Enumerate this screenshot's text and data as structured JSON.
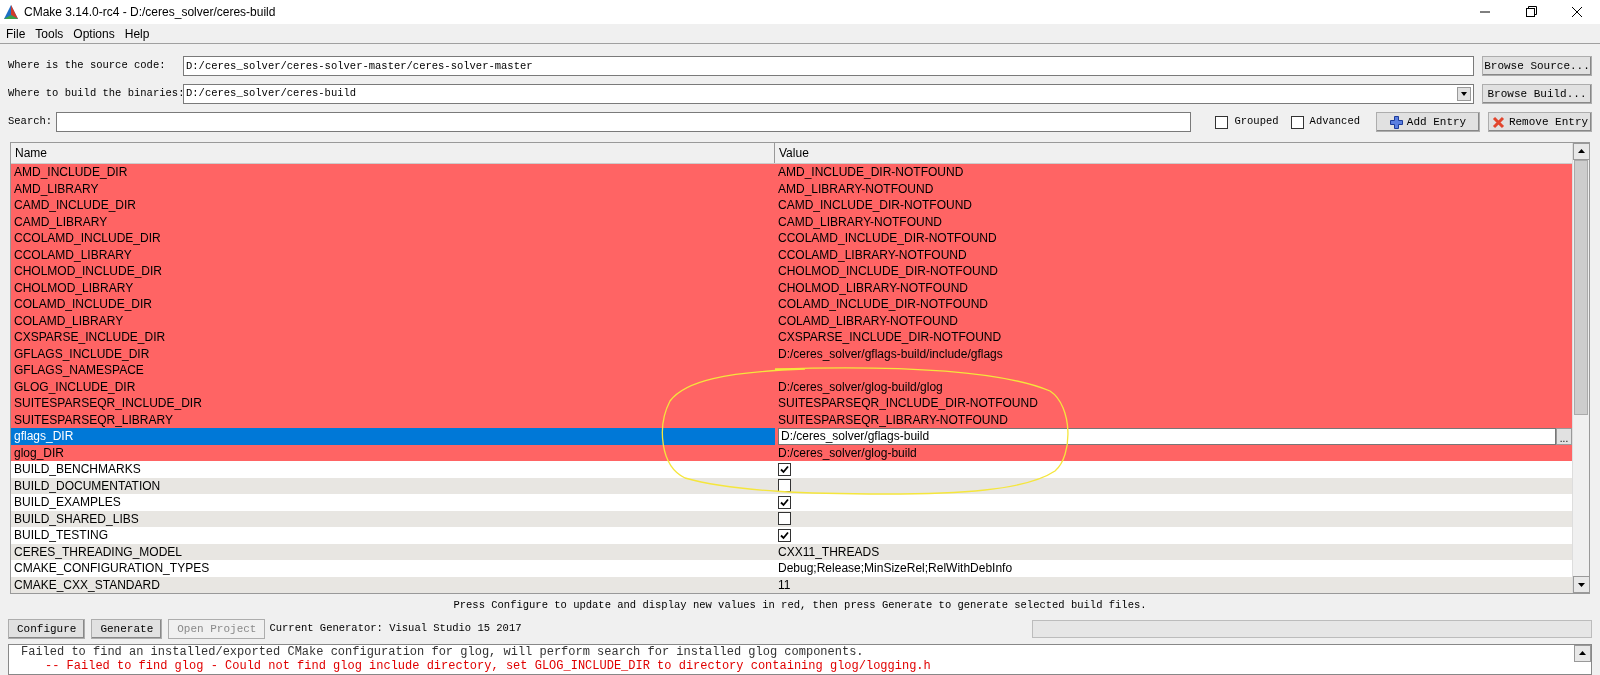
{
  "window": {
    "title": "CMake 3.14.0-rc4 - D:/ceres_solver/ceres-build"
  },
  "menu": [
    "File",
    "Tools",
    "Options",
    "Help"
  ],
  "source": {
    "label": "Where is the source code:",
    "value": "D:/ceres_solver/ceres-solver-master/ceres-solver-master",
    "button": "Browse Source..."
  },
  "build": {
    "label": "Where to build the binaries:",
    "value": "D:/ceres_solver/ceres-build",
    "button": "Browse Build..."
  },
  "search": {
    "label": "Search:"
  },
  "options": [
    {
      "label": "Grouped",
      "checked": false
    },
    {
      "label": "Advanced",
      "checked": false
    }
  ],
  "entry_buttons": [
    {
      "kind": "add",
      "label": "Add Entry"
    },
    {
      "kind": "remove",
      "label": "Remove Entry"
    }
  ],
  "table": {
    "columns": [
      "Name",
      "Value"
    ],
    "rows": [
      {
        "name": "AMD_INCLUDE_DIR",
        "kind": "text",
        "value": "AMD_INCLUDE_DIR-NOTFOUND",
        "new": true,
        "selected": false
      },
      {
        "name": "AMD_LIBRARY",
        "kind": "text",
        "value": "AMD_LIBRARY-NOTFOUND",
        "new": true,
        "selected": false
      },
      {
        "name": "CAMD_INCLUDE_DIR",
        "kind": "text",
        "value": "CAMD_INCLUDE_DIR-NOTFOUND",
        "new": true,
        "selected": false
      },
      {
        "name": "CAMD_LIBRARY",
        "kind": "text",
        "value": "CAMD_LIBRARY-NOTFOUND",
        "new": true,
        "selected": false
      },
      {
        "name": "CCOLAMD_INCLUDE_DIR",
        "kind": "text",
        "value": "CCOLAMD_INCLUDE_DIR-NOTFOUND",
        "new": true,
        "selected": false
      },
      {
        "name": "CCOLAMD_LIBRARY",
        "kind": "text",
        "value": "CCOLAMD_LIBRARY-NOTFOUND",
        "new": true,
        "selected": false
      },
      {
        "name": "CHOLMOD_INCLUDE_DIR",
        "kind": "text",
        "value": "CHOLMOD_INCLUDE_DIR-NOTFOUND",
        "new": true,
        "selected": false
      },
      {
        "name": "CHOLMOD_LIBRARY",
        "kind": "text",
        "value": "CHOLMOD_LIBRARY-NOTFOUND",
        "new": true,
        "selected": false
      },
      {
        "name": "COLAMD_INCLUDE_DIR",
        "kind": "text",
        "value": "COLAMD_INCLUDE_DIR-NOTFOUND",
        "new": true,
        "selected": false
      },
      {
        "name": "COLAMD_LIBRARY",
        "kind": "text",
        "value": "COLAMD_LIBRARY-NOTFOUND",
        "new": true,
        "selected": false
      },
      {
        "name": "CXSPARSE_INCLUDE_DIR",
        "kind": "text",
        "value": "CXSPARSE_INCLUDE_DIR-NOTFOUND",
        "new": true,
        "selected": false
      },
      {
        "name": "GFLAGS_INCLUDE_DIR",
        "kind": "text",
        "value": "D:/ceres_solver/gflags-build/include/gflags",
        "new": true,
        "selected": false
      },
      {
        "name": "GFLAGS_NAMESPACE",
        "kind": "text",
        "new": true,
        "selected": false
      },
      {
        "name": "GLOG_INCLUDE_DIR",
        "kind": "text",
        "value": "D:/ceres_solver/glog-build/glog",
        "new": true,
        "selected": false
      },
      {
        "name": "SUITESPARSEQR_INCLUDE_DIR",
        "kind": "text",
        "value": "SUITESPARSEQR_INCLUDE_DIR-NOTFOUND",
        "new": true,
        "selected": false
      },
      {
        "name": "SUITESPARSEQR_LIBRARY",
        "kind": "text",
        "value": "SUITESPARSEQR_LIBRARY-NOTFOUND",
        "new": true,
        "selected": false
      },
      {
        "name": "gflags_DIR",
        "kind": "path",
        "value": "D:/ceres_solver/gflags-build",
        "browse": "...",
        "new": true,
        "selected": true
      },
      {
        "name": "glog_DIR",
        "kind": "text",
        "value": "D:/ceres_solver/glog-build",
        "new": true,
        "selected": false
      },
      {
        "name": "BUILD_BENCHMARKS",
        "kind": "bool",
        "checked": true,
        "new": false,
        "selected": false
      },
      {
        "name": "BUILD_DOCUMENTATION",
        "kind": "bool",
        "checked": false,
        "new": false,
        "selected": false
      },
      {
        "name": "BUILD_EXAMPLES",
        "kind": "bool",
        "checked": true,
        "new": false,
        "selected": false
      },
      {
        "name": "BUILD_SHARED_LIBS",
        "kind": "bool",
        "checked": false,
        "new": false,
        "selected": false
      },
      {
        "name": "BUILD_TESTING",
        "kind": "bool",
        "checked": true,
        "new": false,
        "selected": false
      },
      {
        "name": "CERES_THREADING_MODEL",
        "kind": "text",
        "value": "CXX11_THREADS",
        "new": false,
        "selected": false
      },
      {
        "name": "CMAKE_CONFIGURATION_TYPES",
        "kind": "text",
        "value": "Debug;Release;MinSizeRel;RelWithDebInfo",
        "new": false,
        "selected": false
      },
      {
        "name": "CMAKE_CXX_STANDARD",
        "kind": "text",
        "value": "11",
        "new": false,
        "selected": false
      }
    ]
  },
  "hint": "Press Configure to update and display new values in red, then press Generate to generate selected build files.",
  "actions": [
    {
      "label": "Configure",
      "disabled": false
    },
    {
      "label": "Generate",
      "disabled": false
    },
    {
      "label": "Open Project",
      "disabled": true
    }
  ],
  "generator": "Current Generator: Visual Studio 15 2017",
  "progress": {
    "level": 0
  },
  "log": [
    {
      "kind": "info",
      "text": "Failed to find an installed/exported CMake configuration for glog, will perform search for installed glog components."
    },
    {
      "kind": "error",
      "text": "-- Failed to find glog - Could not find glog include directory, set GLOG_INCLUDE_DIR to directory containing glog/logging.h"
    }
  ]
}
